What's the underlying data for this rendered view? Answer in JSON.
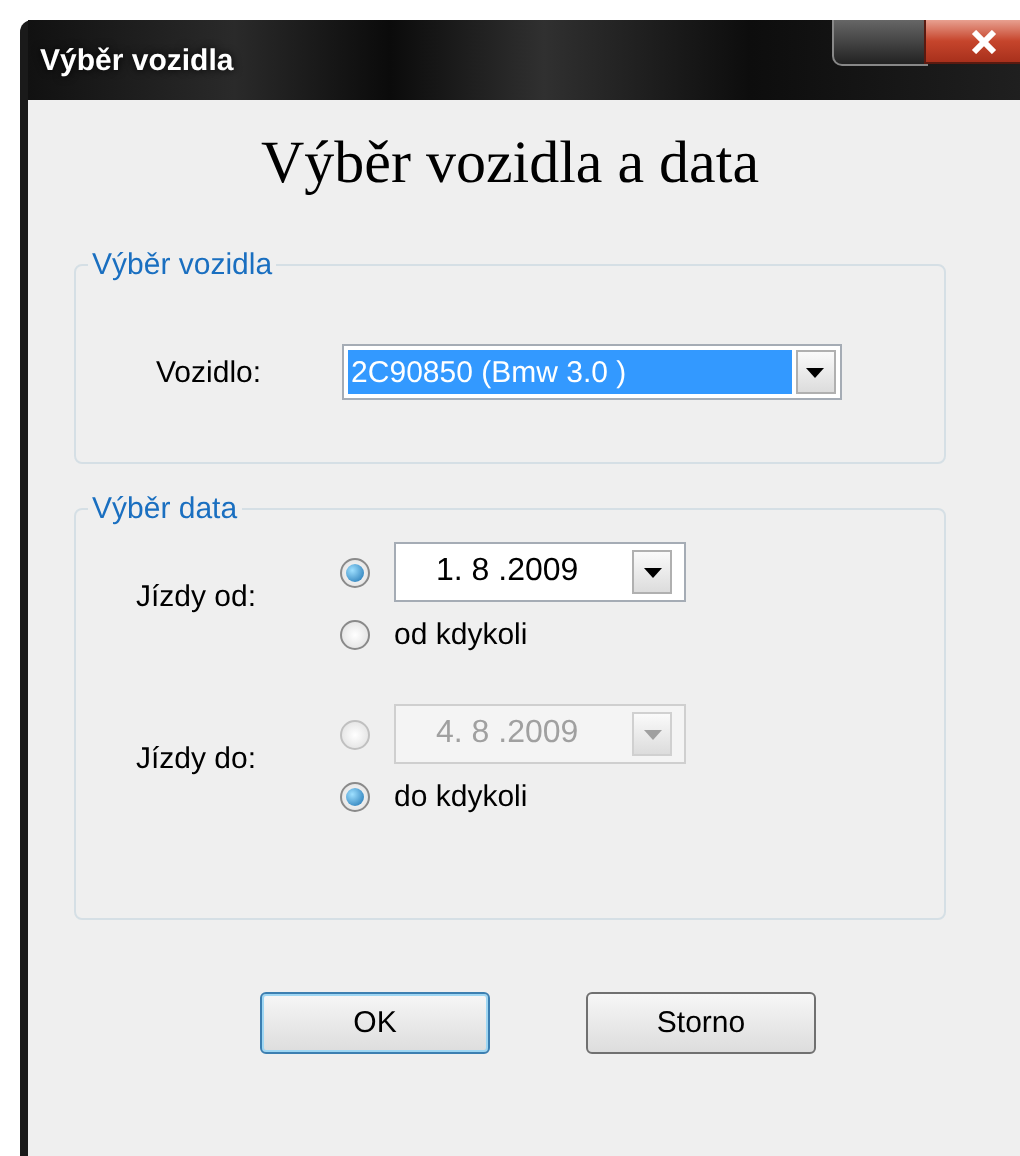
{
  "window": {
    "title": "Výběr vozidla"
  },
  "heading": "Výběr vozidla a data",
  "vehicle_group": {
    "legend": "Výběr vozidla",
    "label": "Vozidlo:",
    "combo": {
      "value": "2C90850 (Bmw 3.0 )",
      "selected": true
    }
  },
  "date_group": {
    "legend": "Výběr data",
    "rows": [
      {
        "label": "Jízdy od:",
        "options": [
          {
            "kind": "date",
            "selected": true,
            "disabled": false,
            "value": "1. 8 .2009"
          },
          {
            "kind": "text",
            "selected": false,
            "label": "od kdykoli"
          }
        ]
      },
      {
        "label": "Jízdy do:",
        "options": [
          {
            "kind": "date",
            "selected": false,
            "disabled": true,
            "value": "4. 8 .2009"
          },
          {
            "kind": "text",
            "selected": true,
            "label": "do kdykoli"
          }
        ]
      }
    ]
  },
  "buttons": [
    {
      "label": "OK",
      "default": true
    },
    {
      "label": "Storno",
      "default": false
    }
  ]
}
